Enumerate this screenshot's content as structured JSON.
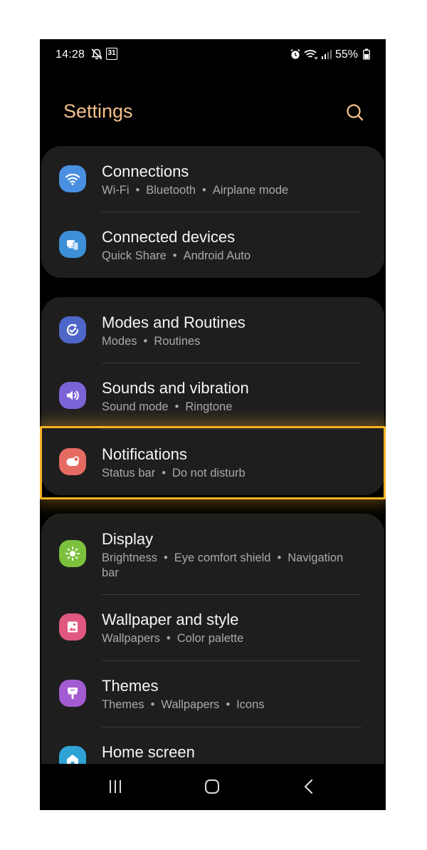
{
  "status_bar": {
    "time": "14:28",
    "calendar_day": "31",
    "battery": "55%"
  },
  "header": {
    "title": "Settings"
  },
  "groups": [
    {
      "items": [
        {
          "label": "Connections",
          "subs": [
            "Wi-Fi",
            "Bluetooth",
            "Airplane mode"
          ],
          "icon": "wifi-icon",
          "color": "#4a90e2"
        },
        {
          "label": "Connected devices",
          "subs": [
            "Quick Share",
            "Android Auto"
          ],
          "icon": "devices-icon",
          "color": "#3d8fd6"
        }
      ]
    },
    {
      "items": [
        {
          "label": "Modes and Routines",
          "subs": [
            "Modes",
            "Routines"
          ],
          "icon": "routines-icon",
          "color": "#4f66c9"
        },
        {
          "label": "Sounds and vibration",
          "subs": [
            "Sound mode",
            "Ringtone"
          ],
          "icon": "volume-icon",
          "color": "#7b63d6"
        },
        {
          "label": "Notifications",
          "subs": [
            "Status bar",
            "Do not disturb"
          ],
          "icon": "notifications-icon",
          "color": "#e56b62"
        }
      ]
    },
    {
      "items": [
        {
          "label": "Display",
          "subs": [
            "Brightness",
            "Eye comfort shield",
            "Navigation bar"
          ],
          "icon": "brightness-icon",
          "color": "#7cc13d"
        },
        {
          "label": "Wallpaper and style",
          "subs": [
            "Wallpapers",
            "Color palette"
          ],
          "icon": "wallpaper-icon",
          "color": "#e0587f"
        },
        {
          "label": "Themes",
          "subs": [
            "Themes",
            "Wallpapers",
            "Icons"
          ],
          "icon": "themes-icon",
          "color": "#a35bd1"
        },
        {
          "label": "Home screen",
          "subs": [],
          "icon": "home-icon",
          "color": "#2fa3d6"
        }
      ]
    }
  ],
  "nav": {
    "recents": "recents-icon",
    "home": "home-button-icon",
    "back": "back-icon"
  },
  "colors": {
    "title": "#f4c08b",
    "highlight": "#f5b323",
    "card": "#1e1e1e"
  }
}
